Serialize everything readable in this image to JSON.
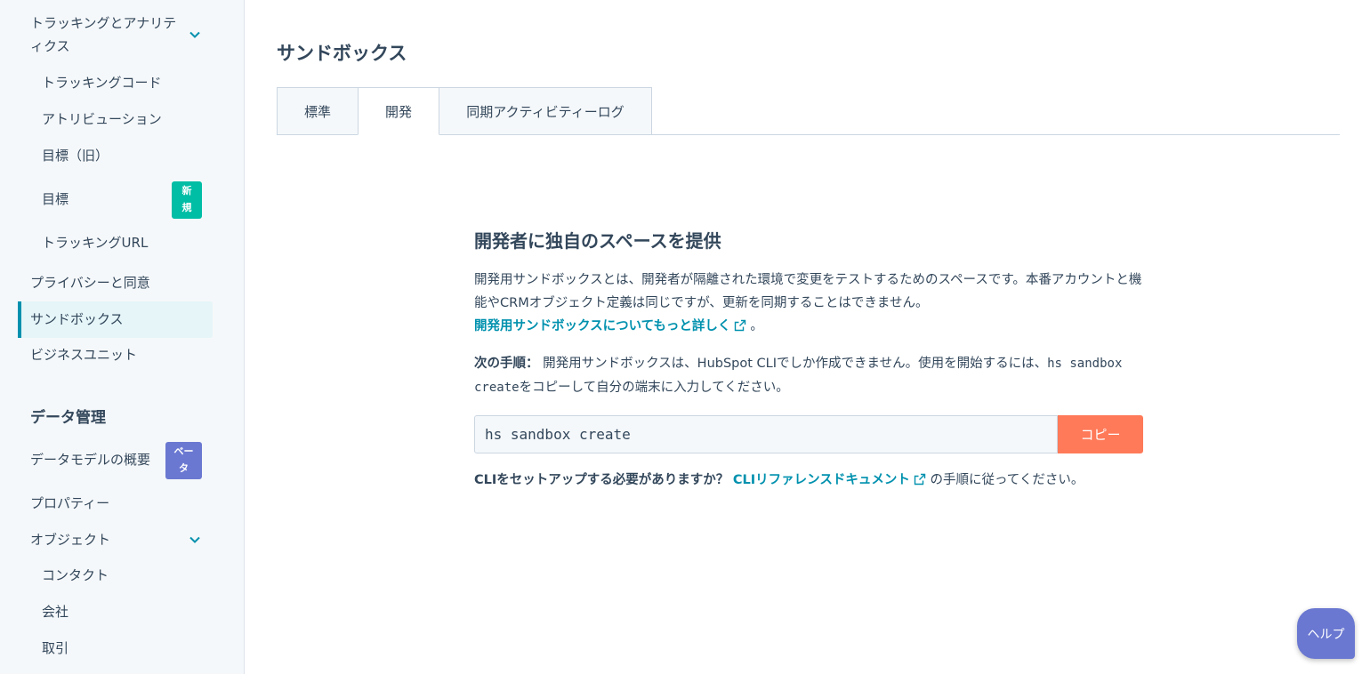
{
  "sidebar": {
    "items": [
      {
        "label": "トラッキングとアナリティクス"
      },
      {
        "label": "トラッキングコード"
      },
      {
        "label": "アトリビューション"
      },
      {
        "label": "目標（旧）"
      },
      {
        "label": "目標",
        "badge": "新規"
      },
      {
        "label": "トラッキングURL"
      },
      {
        "label": "プライバシーと同意"
      },
      {
        "label": "サンドボックス"
      },
      {
        "label": "ビジネスユニット"
      },
      {
        "label": "データモデルの概要",
        "badge": "ベータ"
      },
      {
        "label": "プロパティー"
      },
      {
        "label": "オブジェクト"
      },
      {
        "label": "コンタクト"
      },
      {
        "label": "会社"
      },
      {
        "label": "取引"
      }
    ],
    "section_heading": "データ管理"
  },
  "page": {
    "title": "サンドボックス",
    "tabs": [
      {
        "label": "標準"
      },
      {
        "label": "開発"
      },
      {
        "label": "同期アクティビティーログ"
      }
    ]
  },
  "content": {
    "title": "開発者に独自のスペースを提供",
    "description": "開発用サンドボックスとは、開発者が隔離された環境で変更をテストするためのスペースです。本番アカウントと機能やCRMオブジェクト定義は同じですが、更新を同期することはできません。",
    "learn_more_link": "開発用サンドボックスについてもっと詳しく",
    "learn_more_suffix": "。",
    "steps_label": "次の手順：",
    "steps_text_1": "開発用サンドボックスは、HubSpot CLIでしか作成できません。使用を開始するには、",
    "steps_code": "hs sandbox create",
    "steps_text_2": "をコピーして自分の端末に入力してください。",
    "command": "hs sandbox create",
    "copy_button": "コピー",
    "cli_question": "CLIをセットアップする必要がありますか？",
    "cli_link": "CLIリファレンスドキュメント",
    "cli_suffix": "の手順に従ってください。"
  },
  "help_button": "ヘルプ",
  "colors": {
    "accent": "#0091ae",
    "copy_button": "#ff7a59",
    "badge_new": "#00bda5",
    "badge_beta": "#6a78d1",
    "help": "#6a78d1"
  },
  "icons": [
    "chevron-down-icon",
    "external-link-icon"
  ]
}
